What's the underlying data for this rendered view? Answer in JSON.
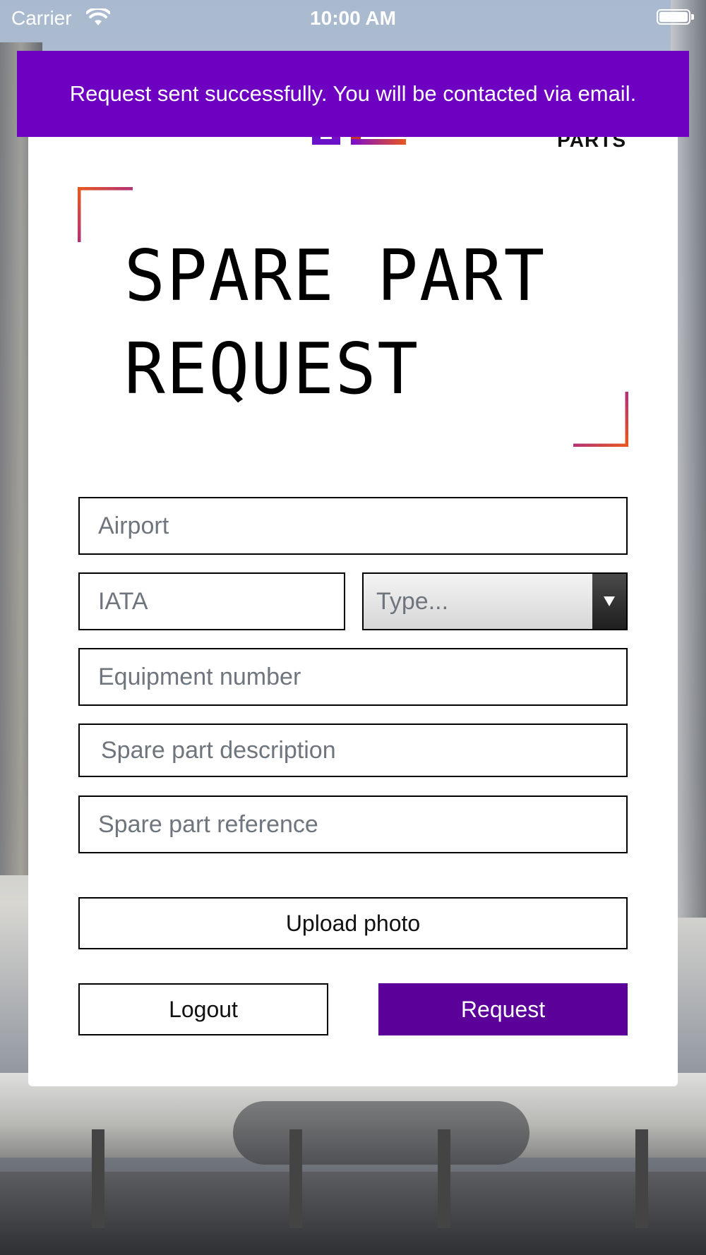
{
  "status_bar": {
    "carrier": "Carrier",
    "time": "10:00 AM"
  },
  "toast": {
    "message": "Request sent successfully. You will be contacted via email."
  },
  "brand": {
    "sub_label": "PARTS"
  },
  "form": {
    "title_line1": "SPARE PART",
    "title_line2": "REQUEST",
    "airport_placeholder": "Airport",
    "iata_placeholder": "IATA",
    "type_placeholder": "Type...",
    "equipment_placeholder": "Equipment number",
    "description_placeholder": "Spare part description",
    "reference_placeholder": "Spare part reference"
  },
  "actions": {
    "upload_label": "Upload photo",
    "logout_label": "Logout",
    "request_label": "Request"
  },
  "colors": {
    "accent_purple": "#5b0099",
    "toast_purple": "#6e00c2",
    "gradient_orange": "#e8571e"
  }
}
